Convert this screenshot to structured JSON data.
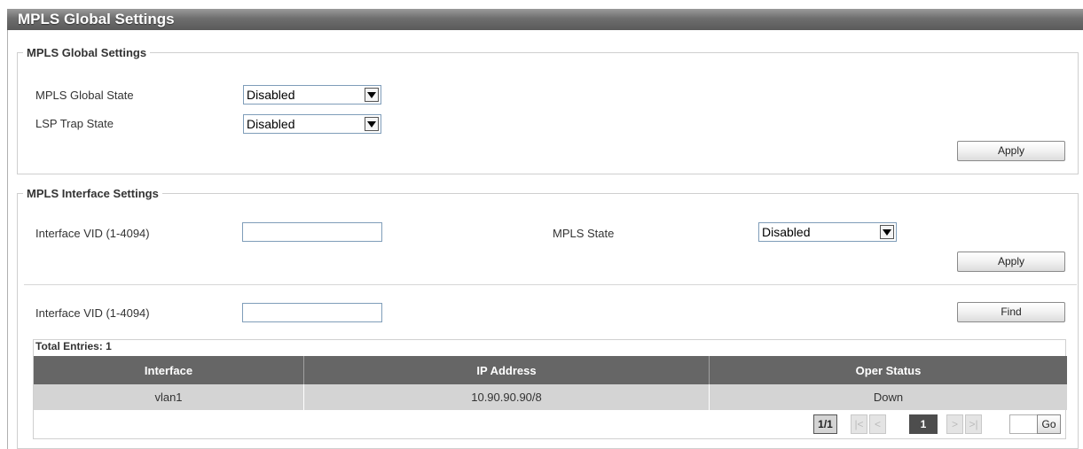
{
  "page_title": "MPLS Global Settings",
  "global_section": {
    "legend": "MPLS Global Settings",
    "mpls_global_state_label": "MPLS Global State",
    "mpls_global_state_value": "Disabled",
    "lsp_trap_state_label": "LSP Trap State",
    "lsp_trap_state_value": "Disabled",
    "apply_label": "Apply"
  },
  "interface_section": {
    "legend": "MPLS Interface Settings",
    "interface_vid_label": "Interface VID (1-4094)",
    "interface_vid_value": "",
    "mpls_state_label": "MPLS State",
    "mpls_state_value": "Disabled",
    "apply_label": "Apply",
    "find_vid_label": "Interface VID (1-4094)",
    "find_vid_value": "",
    "find_label": "Find"
  },
  "table": {
    "total_entries": "Total Entries: 1",
    "columns": [
      "Interface",
      "IP Address",
      "Oper Status"
    ],
    "rows": [
      [
        "vlan1",
        "10.90.90.90/8",
        "Down"
      ]
    ]
  },
  "pagination": {
    "page_indicator": "1/1",
    "first": "|<",
    "prev": "<",
    "current_page": "1",
    "next": ">",
    "last": ">|",
    "goto_value": "",
    "go_label": "Go"
  }
}
